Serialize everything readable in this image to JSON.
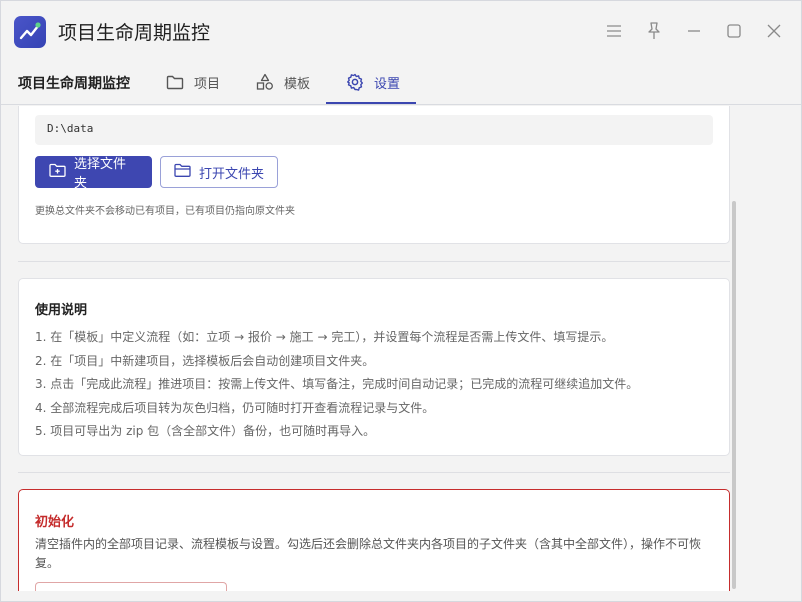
{
  "window": {
    "title": "项目生命周期监控",
    "controls": [
      "menu-icon",
      "pin-icon",
      "minimize-icon",
      "maximize-icon",
      "close-icon"
    ]
  },
  "tabbar": {
    "brand": "项目生命周期监控",
    "tabs": [
      {
        "label": "项目",
        "icon": "folder-icon"
      },
      {
        "label": "模板",
        "icon": "shapes-icon"
      },
      {
        "label": "设置",
        "icon": "gear-icon",
        "active": true
      }
    ]
  },
  "storage": {
    "path": "D:\\data",
    "choose_folder": "选择文件夹",
    "open_folder": "打开文件夹",
    "hint": "更换总文件夹不会移动已有项目，已有项目仍指向原文件夹"
  },
  "usage": {
    "title": "使用说明",
    "items": [
      "1. 在「模板」中定义流程（如：立项 → 报价 → 施工 → 完工），并设置每个流程是否需上传文件、填写提示。",
      "2. 在「项目」中新建项目，选择模板后会自动创建项目文件夹。",
      "3. 点击「完成此流程」推进项目：按需上传文件、填写备注，完成时间自动记录；已完成的流程可继续追加文件。",
      "4. 全部流程完成后项目转为灰色归档，仍可随时打开查看流程记录与文件。",
      "5. 项目可导出为 zip 包（含全部文件）备份，也可随时再导入。"
    ]
  },
  "init": {
    "title": "初始化",
    "description": "清空插件内的全部项目记录、流程模板与设置。勾选后还会删除总文件夹内各项目的子文件夹（含其中全部文件），操作不可恢复。"
  },
  "colors": {
    "accent": "#3e47b1",
    "danger": "#c42b2b",
    "background": "#f3f3f3"
  }
}
